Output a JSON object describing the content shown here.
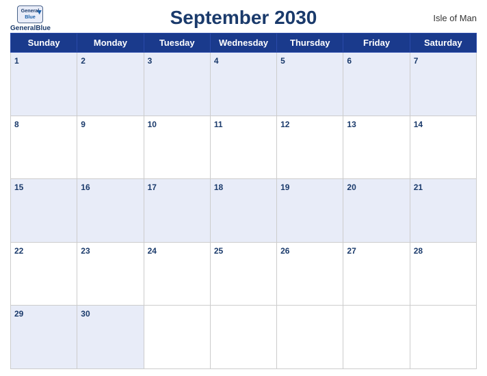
{
  "header": {
    "title": "September 2030",
    "logo_line1": "General",
    "logo_line2": "Blue",
    "region": "Isle of Man"
  },
  "days_of_week": [
    "Sunday",
    "Monday",
    "Tuesday",
    "Wednesday",
    "Thursday",
    "Friday",
    "Saturday"
  ],
  "weeks": [
    [
      {
        "day": "1",
        "empty": false
      },
      {
        "day": "2",
        "empty": false
      },
      {
        "day": "3",
        "empty": false
      },
      {
        "day": "4",
        "empty": false
      },
      {
        "day": "5",
        "empty": false
      },
      {
        "day": "6",
        "empty": false
      },
      {
        "day": "7",
        "empty": false
      }
    ],
    [
      {
        "day": "8",
        "empty": false
      },
      {
        "day": "9",
        "empty": false
      },
      {
        "day": "10",
        "empty": false
      },
      {
        "day": "11",
        "empty": false
      },
      {
        "day": "12",
        "empty": false
      },
      {
        "day": "13",
        "empty": false
      },
      {
        "day": "14",
        "empty": false
      }
    ],
    [
      {
        "day": "15",
        "empty": false
      },
      {
        "day": "16",
        "empty": false
      },
      {
        "day": "17",
        "empty": false
      },
      {
        "day": "18",
        "empty": false
      },
      {
        "day": "19",
        "empty": false
      },
      {
        "day": "20",
        "empty": false
      },
      {
        "day": "21",
        "empty": false
      }
    ],
    [
      {
        "day": "22",
        "empty": false
      },
      {
        "day": "23",
        "empty": false
      },
      {
        "day": "24",
        "empty": false
      },
      {
        "day": "25",
        "empty": false
      },
      {
        "day": "26",
        "empty": false
      },
      {
        "day": "27",
        "empty": false
      },
      {
        "day": "28",
        "empty": false
      }
    ],
    [
      {
        "day": "29",
        "empty": false
      },
      {
        "day": "30",
        "empty": false
      },
      {
        "day": "",
        "empty": true
      },
      {
        "day": "",
        "empty": true
      },
      {
        "day": "",
        "empty": true
      },
      {
        "day": "",
        "empty": true
      },
      {
        "day": "",
        "empty": true
      }
    ]
  ],
  "colors": {
    "header_bg": "#1a3a8c",
    "odd_row_bg": "#e8ecf8",
    "even_row_bg": "#ffffff",
    "title_color": "#1a3a6b"
  }
}
